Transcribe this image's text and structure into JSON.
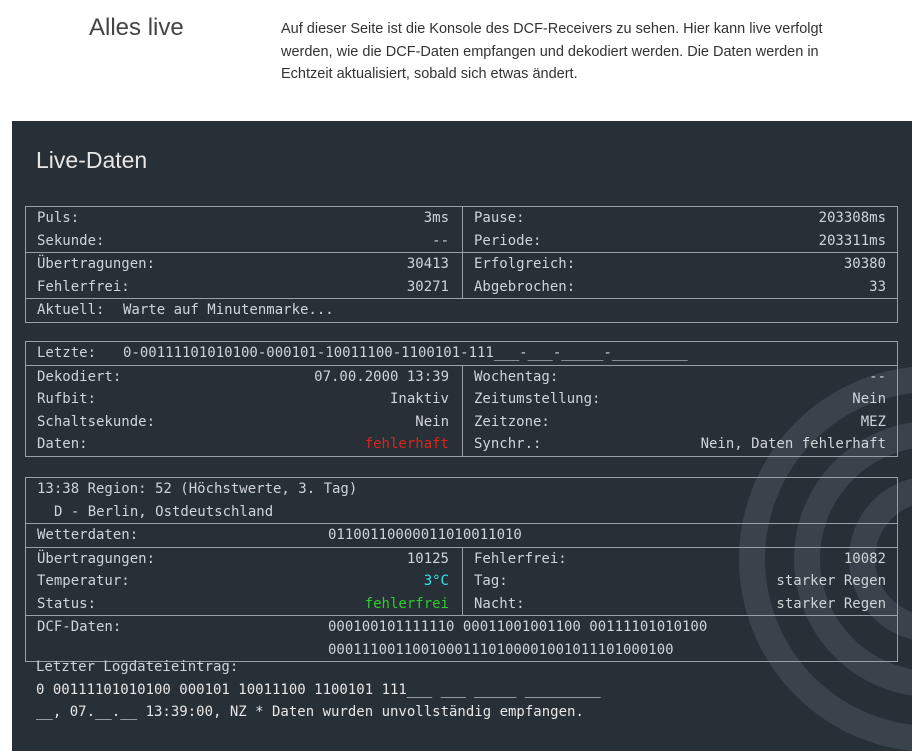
{
  "intro": {
    "title": "Alles live",
    "text_lines": [
      "Auf dieser Seite ist die Konsole des DCF-Receivers zu sehen. Hier kann live verfolgt",
      "werden, wie die DCF-Daten empfangen und dekodiert werden. Die Daten werden in",
      "Echtzeit aktualisiert, sobald sich etwas ändert."
    ]
  },
  "panel": {
    "title": "Live-Daten",
    "stats": {
      "puls_label": "Puls:",
      "puls_value": "3",
      "puls_unit": "ms",
      "pause_label": "Pause:",
      "pause_value": "203308",
      "pause_unit": "ms",
      "sekunde_label": "Sekunde:",
      "sekunde_value": "--",
      "periode_label": "Periode:",
      "periode_value": "203311",
      "periode_unit": "ms",
      "uebertragungen_label": "Übertragungen:",
      "uebertragungen_value": "30413",
      "erfolgreich_label": "Erfolgreich:",
      "erfolgreich_value": "30380",
      "fehlerfrei_label": "Fehlerfrei:",
      "fehlerfrei_value": "30271",
      "abgebrochen_label": "Abgebrochen:",
      "abgebrochen_value": "33",
      "aktuell_label": "Aktuell:",
      "aktuell_value": "Warte auf Minutenmarke..."
    },
    "decode": {
      "letzte_label": "Letzte:",
      "letzte_value": "0-00111101010100-000101-10011100-1100101-111___-___-_____-_________",
      "dekodiert_label": "Dekodiert:",
      "dekodiert_value": "07.00.2000 13:39",
      "wochentag_label": "Wochentag:",
      "wochentag_value": "--",
      "rufbit_label": "Rufbit:",
      "rufbit_value": "Inaktiv",
      "zeitumstellung_label": "Zeitumstellung:",
      "zeitumstellung_value": "Nein",
      "schaltsekunde_label": "Schaltsekunde:",
      "schaltsekunde_value": "Nein",
      "zeitzone_label": "Zeitzone:",
      "zeitzone_value": "MEZ",
      "daten_label": "Daten:",
      "daten_value": "fehlerhaft",
      "synchr_label": "Synchr.:",
      "synchr_value": "Nein, Daten fehlerhaft"
    },
    "weather": {
      "header_line1": "13:38 Region: 52 (Höchstwerte, 3. Tag)",
      "header_line2": "D - Berlin, Ostdeutschland",
      "wetterdaten_label": "Wetterdaten:",
      "wetterdaten_value": "01100110000011010011010",
      "uebertragungen_label": "Übertragungen:",
      "uebertragungen_value": "10125",
      "fehlerfrei_label": "Fehlerfrei:",
      "fehlerfrei_value": "10082",
      "temperatur_label": "Temperatur:",
      "temperatur_value": "3°C",
      "tag_label": "Tag:",
      "tag_value": "starker Regen",
      "status_label": "Status:",
      "status_value": "fehlerfrei",
      "nacht_label": "Nacht:",
      "nacht_value": "starker Regen",
      "dcf_label": "DCF-Daten:",
      "dcf_value_line1": "000100101111110 00011001001100 00111101010100",
      "dcf_value_line2": "00011100110010001110100001001011101000100"
    },
    "log": {
      "label": "Letzter Logdateieintrag:",
      "line1": "0 00111101010100 000101 10011100 1100101 111___ ___ _____ _________",
      "line2": "__, 07.__.__ 13:39:00, NZ * Daten wurden unvollständig empfangen."
    },
    "colors": {
      "background": "#283037",
      "border": "#9aa0a6",
      "text": "#cfd4d8",
      "error": "#d9241e",
      "ok": "#2ecc2e",
      "temp": "#2ee6e6"
    },
    "icons": {
      "watermark": "signal-waves-icon"
    }
  }
}
